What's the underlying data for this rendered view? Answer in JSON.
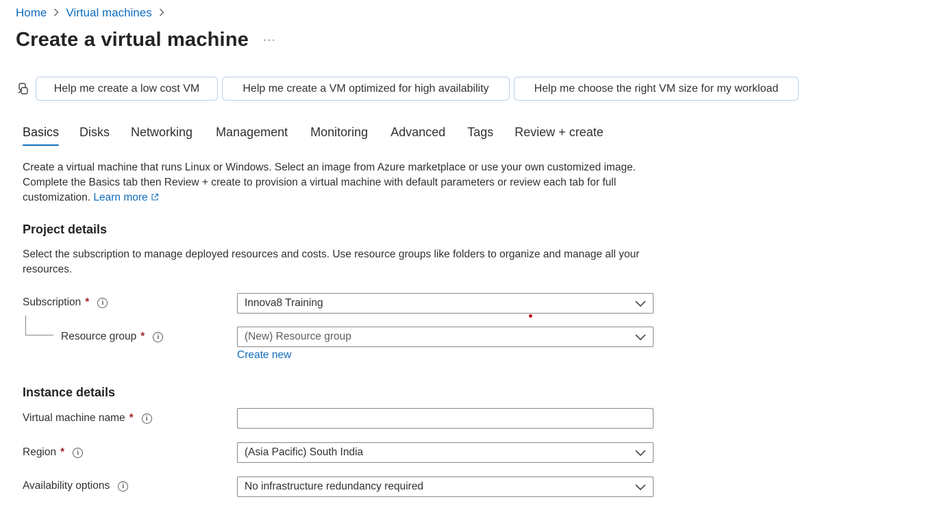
{
  "breadcrumb": {
    "home": "Home",
    "virtual_machines": "Virtual machines",
    "separator": ">"
  },
  "page": {
    "title": "Create a virtual machine",
    "more": "···"
  },
  "copilot": {
    "icon": "copilot-icon",
    "buttons": [
      "Help me create a low cost VM",
      "Help me create a VM optimized for high availability",
      "Help me choose the right VM size for my workload"
    ]
  },
  "tabs": [
    "Basics",
    "Disks",
    "Networking",
    "Management",
    "Monitoring",
    "Advanced",
    "Tags",
    "Review + create"
  ],
  "active_tab": "Basics",
  "intro": {
    "text": "Create a virtual machine that runs Linux or Windows. Select an image from Azure marketplace or use your own customized image. Complete the Basics tab then Review + create to provision a virtual machine with default parameters or review each tab for full customization.",
    "learn_more": "Learn more",
    "external_icon": "external-link-icon"
  },
  "project_details": {
    "title": "Project details",
    "description": "Select the subscription to manage deployed resources and costs. Use resource groups like folders to organize and manage all your resources.",
    "subscription": {
      "label": "Subscription",
      "required": "*",
      "value": "Innova8 Training"
    },
    "resource_group": {
      "label": "Resource group",
      "required": "*",
      "placeholder": "(New) Resource group",
      "create_new": "Create new"
    }
  },
  "instance_details": {
    "title": "Instance details",
    "vm_name": {
      "label": "Virtual machine name",
      "required": "*",
      "value": ""
    },
    "region": {
      "label": "Region",
      "required": "*",
      "value": "(Asia Pacific) South India"
    },
    "availability": {
      "label": "Availability options",
      "value": "No infrastructure redundancy required"
    }
  },
  "info_glyph": "i",
  "colors": {
    "accent": "#0f6cbd",
    "required": "#a4262c",
    "border": "#8a8886",
    "help_button_border": "#b9cfe8"
  }
}
